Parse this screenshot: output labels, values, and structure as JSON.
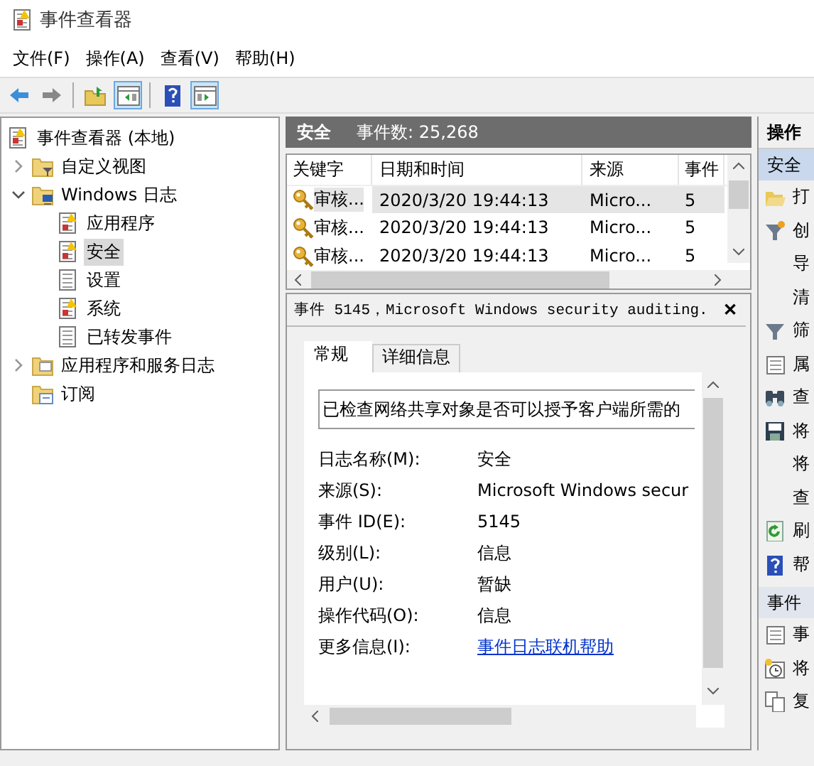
{
  "window": {
    "title": "事件查看器"
  },
  "menu": [
    "文件(F)",
    "操作(A)",
    "查看(V)",
    "帮助(H)"
  ],
  "toolbar": [
    {
      "kind": "back",
      "pressed": false
    },
    {
      "kind": "forward",
      "pressed": false
    },
    {
      "kind": "sep"
    },
    {
      "kind": "up",
      "pressed": false
    },
    {
      "kind": "pane-left",
      "pressed": true
    },
    {
      "kind": "sep"
    },
    {
      "kind": "help",
      "pressed": false
    },
    {
      "kind": "pane-right",
      "pressed": true
    }
  ],
  "tree": [
    {
      "label": "事件查看器 (本地)",
      "kind": "root",
      "selected": false,
      "children": [
        {
          "label": "自定义视图",
          "kind": "filter-folder",
          "selected": false,
          "expanded": false
        },
        {
          "label": "Windows 日志",
          "kind": "win-folder",
          "selected": false,
          "expanded": true,
          "children": [
            {
              "label": "应用程序",
              "kind": "log-warn",
              "selected": false
            },
            {
              "label": "安全",
              "kind": "log-warn",
              "selected": true
            },
            {
              "label": "设置",
              "kind": "log",
              "selected": false
            },
            {
              "label": "系统",
              "kind": "log-warn",
              "selected": false
            },
            {
              "label": "已转发事件",
              "kind": "log",
              "selected": false
            }
          ]
        },
        {
          "label": "应用程序和服务日志",
          "kind": "folder",
          "selected": false,
          "expanded": false
        },
        {
          "label": "订阅",
          "kind": "sub",
          "selected": false
        }
      ]
    }
  ],
  "list": {
    "title": "安全",
    "count": "事件数: 25,268",
    "columns": [
      "关键字",
      "日期和时间",
      "来源",
      "事件"
    ],
    "rows": [
      {
        "cells": [
          "审核...",
          "2020/3/20 19:44:13",
          "Micro...",
          "5"
        ],
        "selected": true
      },
      {
        "cells": [
          "审核...",
          "2020/3/20 19:44:13",
          "Micro...",
          "5"
        ],
        "selected": false
      },
      {
        "cells": [
          "审核...",
          "2020/3/20 19:44:13",
          "Micro...",
          "5"
        ],
        "selected": false
      }
    ]
  },
  "detail": {
    "title": "事件 5145，Microsoft Windows security auditing.",
    "close": "✕",
    "tabs": [
      {
        "label": "常规",
        "selected": true
      },
      {
        "label": "详细信息",
        "selected": false
      }
    ],
    "description": "已检查网络共享对象是否可以授予客户端所需的",
    "fields": [
      {
        "label": "日志名称(M):",
        "value": "安全",
        "kind": "text"
      },
      {
        "label": "来源(S):",
        "value": "Microsoft Windows secur",
        "kind": "text"
      },
      {
        "label": "事件 ID(E):",
        "value": "5145",
        "kind": "text"
      },
      {
        "label": "级别(L):",
        "value": "信息",
        "kind": "text"
      },
      {
        "label": "用户(U):",
        "value": "暂缺",
        "kind": "text"
      },
      {
        "label": "操作代码(O):",
        "value": "信息",
        "kind": "text"
      },
      {
        "label": "更多信息(I):",
        "value": "事件日志联机帮助",
        "kind": "link"
      }
    ]
  },
  "actions": {
    "title": "操作",
    "sections": [
      {
        "title": "安全",
        "selected": true,
        "items": [
          {
            "label": "打",
            "kind": "open"
          },
          {
            "label": "创",
            "kind": "filter-new"
          },
          {
            "label": "导",
            "kind": "none"
          },
          {
            "label": "清",
            "kind": "none"
          },
          {
            "label": "筛",
            "kind": "filter"
          },
          {
            "label": "属",
            "kind": "props"
          },
          {
            "label": "查",
            "kind": "find"
          },
          {
            "label": "将",
            "kind": "save"
          },
          {
            "label": "将",
            "kind": "none"
          },
          {
            "label": "查",
            "kind": "none"
          },
          {
            "label": "刷",
            "kind": "refresh"
          },
          {
            "label": "帮",
            "kind": "help"
          }
        ]
      },
      {
        "title": "事件",
        "selected": false,
        "items": [
          {
            "label": "事",
            "kind": "props"
          },
          {
            "label": "将",
            "kind": "task"
          },
          {
            "label": "复",
            "kind": "copy"
          }
        ]
      }
    ]
  }
}
